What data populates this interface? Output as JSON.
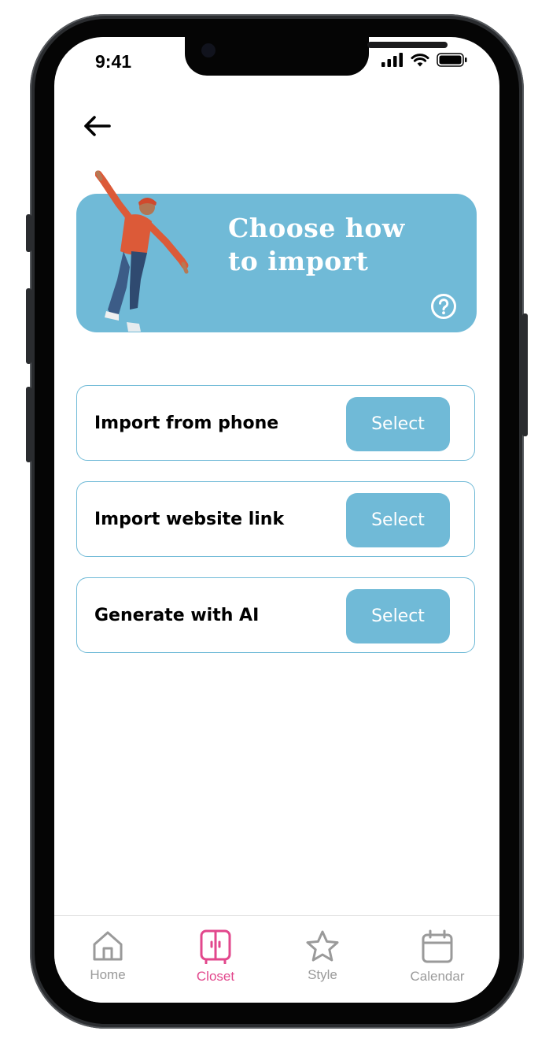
{
  "status_bar": {
    "time": "9:41"
  },
  "header": {
    "back_icon": "arrow-left-icon"
  },
  "hero": {
    "title_line1": "Choose how",
    "title_line2": "to import",
    "help_icon": "question-circle-icon",
    "background_color": "#70bad7"
  },
  "options": [
    {
      "label": "Import from phone",
      "button": "Select"
    },
    {
      "label": "Import website link",
      "button": "Select"
    },
    {
      "label": "Generate with AI",
      "button": "Select"
    }
  ],
  "tabbar": {
    "items": [
      {
        "label": "Home",
        "icon": "home-icon",
        "active": false
      },
      {
        "label": "Closet",
        "icon": "closet-icon",
        "active": true
      },
      {
        "label": "Style",
        "icon": "star-icon",
        "active": false
      },
      {
        "label": "Calendar",
        "icon": "calendar-icon",
        "active": false
      }
    ],
    "active_color": "#e2478c",
    "inactive_color": "#9a9a9a"
  }
}
